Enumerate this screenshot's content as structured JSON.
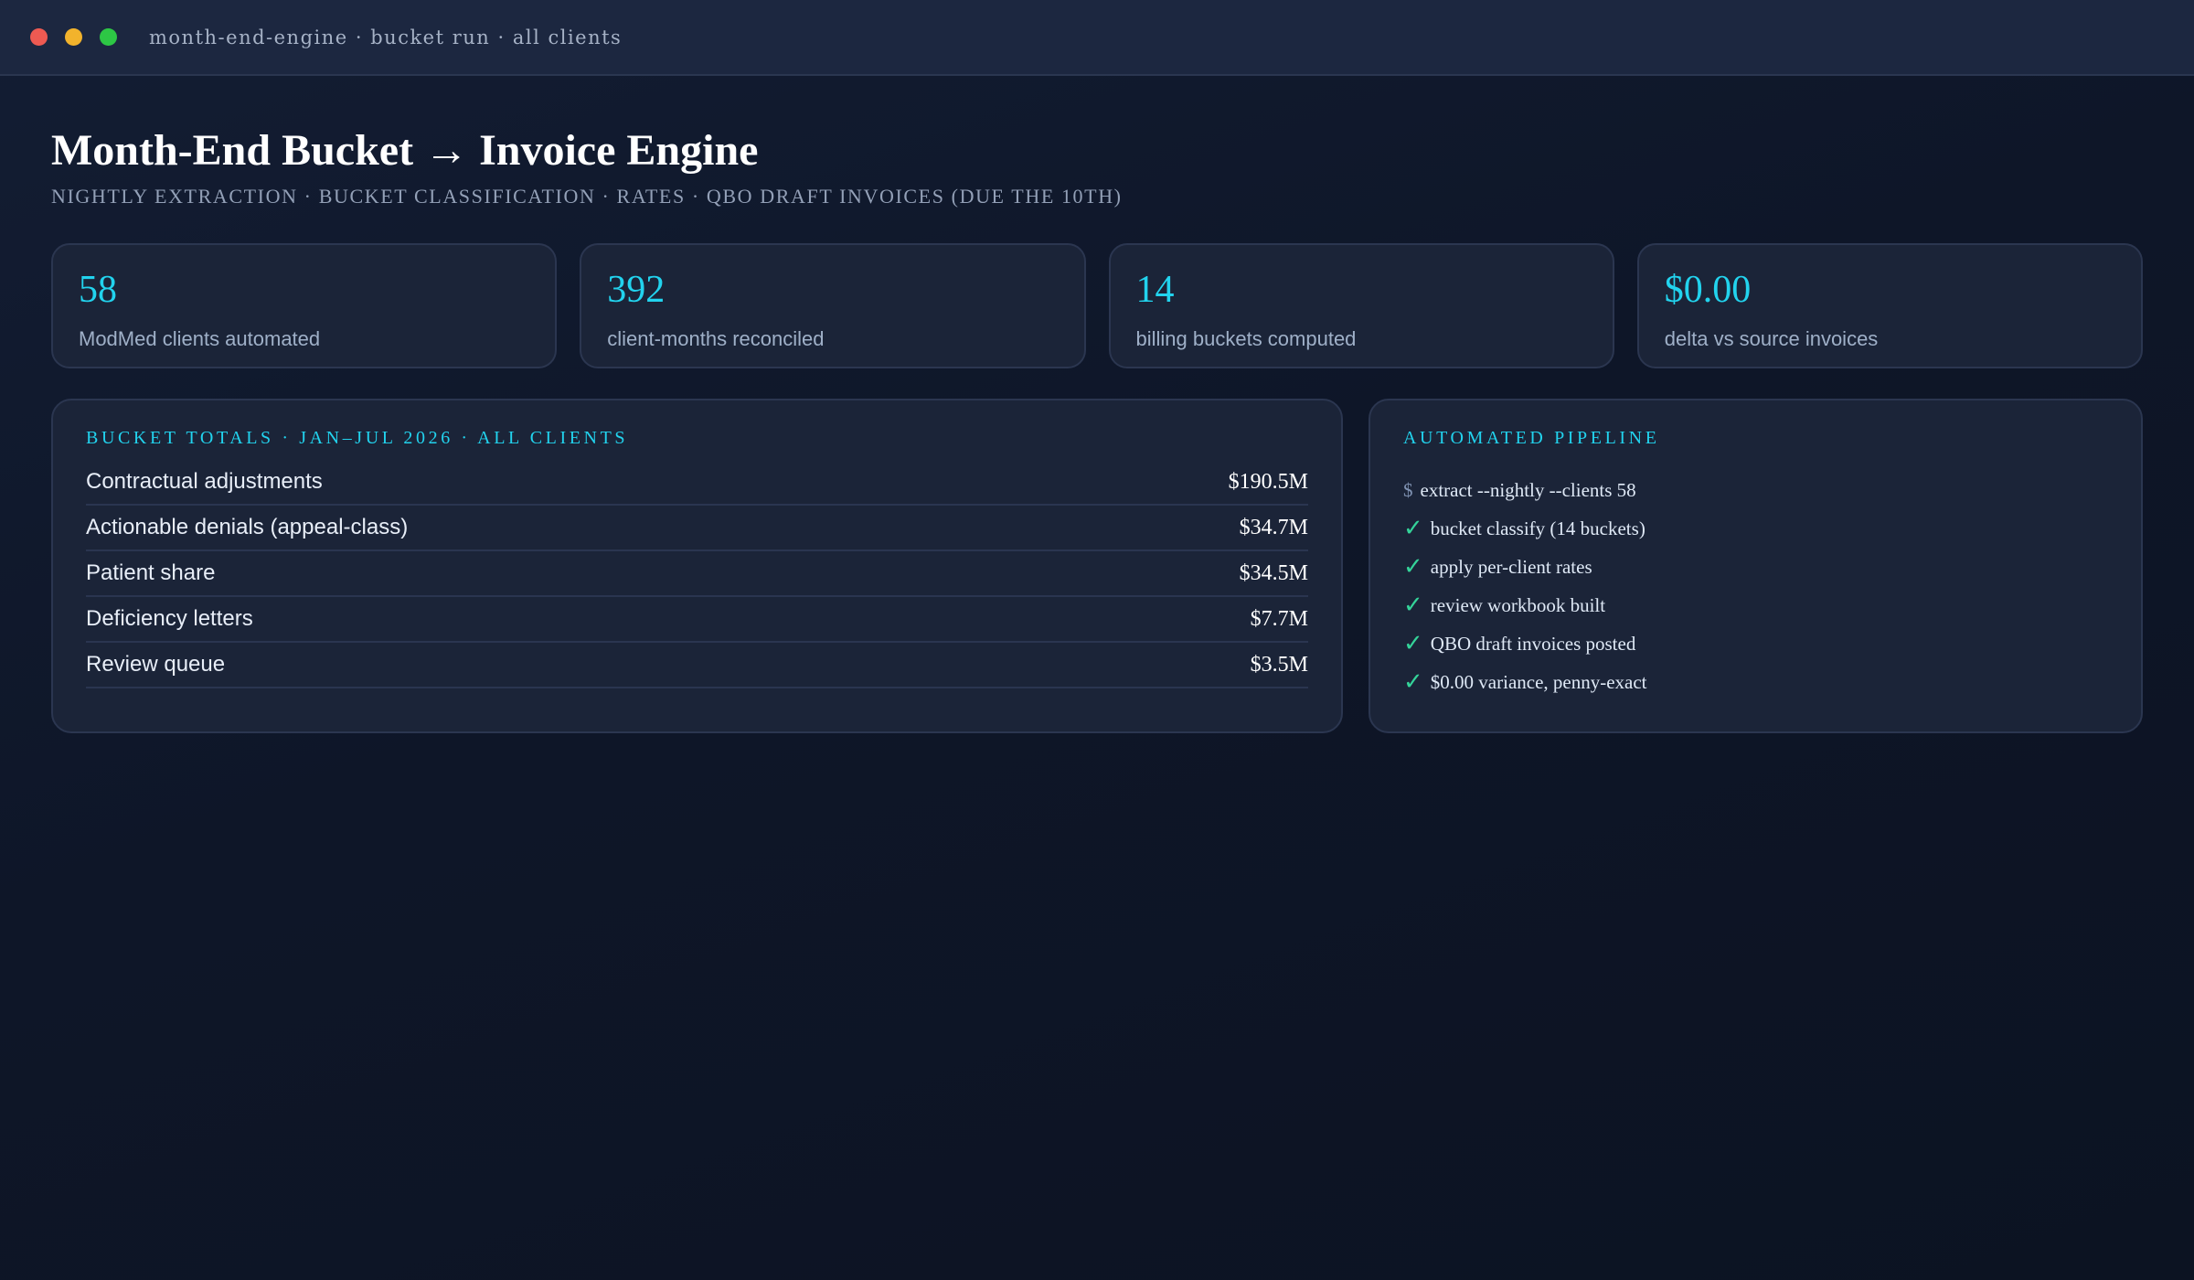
{
  "window": {
    "title": "month-end-engine · bucket run · all clients"
  },
  "header": {
    "title": "Month-End Bucket → Invoice Engine",
    "subtitle": "NIGHTLY EXTRACTION · BUCKET CLASSIFICATION · RATES · QBO DRAFT INVOICES (DUE THE 10TH)"
  },
  "stats": [
    {
      "value": "58",
      "label": "ModMed clients automated"
    },
    {
      "value": "392",
      "label": "client-months reconciled"
    },
    {
      "value": "14",
      "label": "billing buckets computed"
    },
    {
      "value": "$0.00",
      "label": "delta vs source invoices"
    }
  ],
  "totals": {
    "heading": "BUCKET TOTALS · JAN–JUL 2026 · ALL CLIENTS",
    "rows": [
      {
        "label": "Contractual adjustments",
        "value": "$190.5M"
      },
      {
        "label": "Actionable denials (appeal-class)",
        "value": "$34.7M"
      },
      {
        "label": "Patient share",
        "value": "$34.5M"
      },
      {
        "label": "Deficiency letters",
        "value": "$7.7M"
      },
      {
        "label": "Review queue",
        "value": "$3.5M"
      }
    ]
  },
  "pipeline": {
    "heading": "AUTOMATED PIPELINE",
    "prompt_symbol": "$",
    "check_symbol": "✓",
    "command": "extract --nightly --clients 58",
    "steps": [
      "bucket classify (14 buckets)",
      "apply per-client rates",
      "review workbook built",
      "QBO draft invoices posted",
      "$0.00 variance, penny-exact"
    ]
  },
  "colors": {
    "accent": "#22d3ee",
    "success": "#34d399",
    "background": "#0e1628",
    "card": "#1b2438"
  }
}
